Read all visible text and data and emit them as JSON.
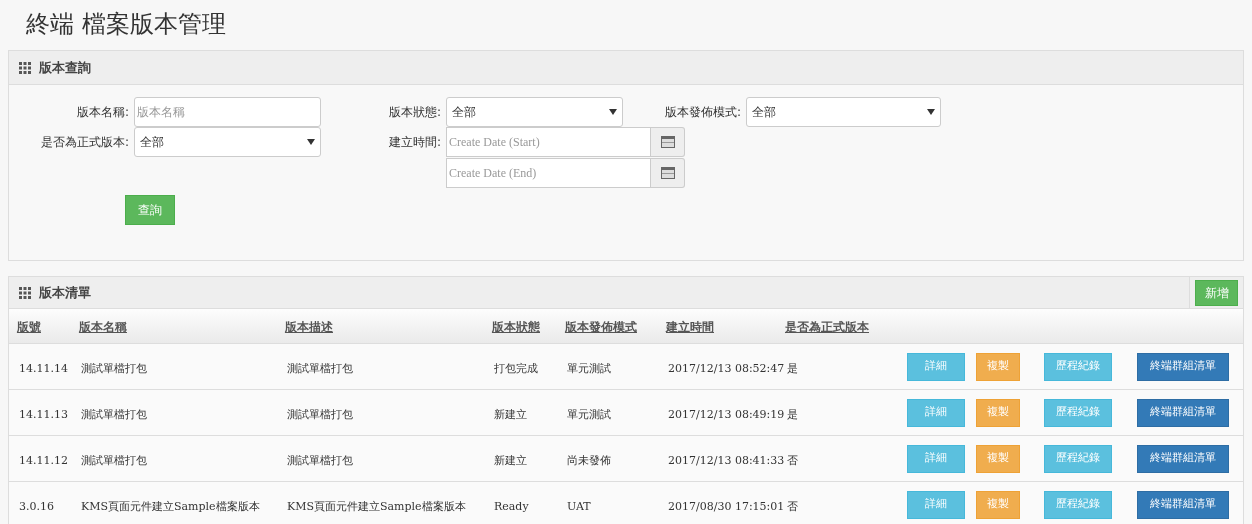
{
  "page_title": "終端 檔案版本管理",
  "query_panel": {
    "title": "版本查詢",
    "fields": [
      {
        "kind": "text",
        "label": "版本名稱:",
        "placeholder": "版本名稱"
      },
      {
        "kind": "select",
        "label": "版本狀態:",
        "value": "全部"
      },
      {
        "kind": "select",
        "label": "版本發佈模式:",
        "value": "全部"
      },
      {
        "kind": "select",
        "label": "是否為正式版本:",
        "value": "全部"
      },
      {
        "kind": "daterange",
        "label": "建立時間:",
        "placeholders": [
          "Create Date (Start)",
          "Create Date (End)"
        ]
      }
    ],
    "search_button": "查詢"
  },
  "list_panel": {
    "title": "版本清單",
    "add_button": "新增",
    "columns": [
      "版號",
      "版本名稱",
      "版本描述",
      "版本狀態",
      "版本發佈模式",
      "建立時間",
      "是否為正式版本"
    ],
    "rows": [
      {
        "cells": [
          "14.11.14",
          "測試單檔打包",
          "測試單檔打包",
          "打包完成",
          "單元測試",
          "2017/12/13 08:52:47",
          "是"
        ],
        "actions": [
          {
            "kind": "info",
            "label": "詳細"
          },
          {
            "kind": "warning",
            "label": "複製"
          },
          {
            "kind": "info",
            "label": "歷程紀錄"
          },
          {
            "kind": "primary",
            "label": "終端群組清單"
          }
        ]
      },
      {
        "cells": [
          "14.11.13",
          "測試單檔打包",
          "測試單檔打包",
          "新建立",
          "單元測試",
          "2017/12/13 08:49:19",
          "是"
        ],
        "actions": [
          {
            "kind": "info",
            "label": "詳細"
          },
          {
            "kind": "warning",
            "label": "複製"
          },
          {
            "kind": "info",
            "label": "歷程紀錄"
          },
          {
            "kind": "primary",
            "label": "終端群組清單"
          }
        ]
      },
      {
        "cells": [
          "14.11.12",
          "測試單檔打包",
          "測試單檔打包",
          "新建立",
          "尚未發佈",
          "2017/12/13 08:41:33",
          "否"
        ],
        "actions": [
          {
            "kind": "info",
            "label": "詳細"
          },
          {
            "kind": "warning",
            "label": "複製"
          },
          {
            "kind": "info",
            "label": "歷程紀錄"
          },
          {
            "kind": "primary",
            "label": "終端群組清單"
          }
        ]
      },
      {
        "cells": [
          "3.0.16",
          "KMS頁面元件建立Sample檔案版本",
          "KMS頁面元件建立Sample檔案版本",
          "Ready",
          "UAT",
          "2017/08/30 17:15:01",
          "否"
        ],
        "actions": [
          {
            "kind": "info",
            "label": "詳細"
          },
          {
            "kind": "warning",
            "label": "複製"
          },
          {
            "kind": "info",
            "label": "歷程紀錄"
          },
          {
            "kind": "primary",
            "label": "終端群組清單"
          }
        ]
      }
    ]
  }
}
